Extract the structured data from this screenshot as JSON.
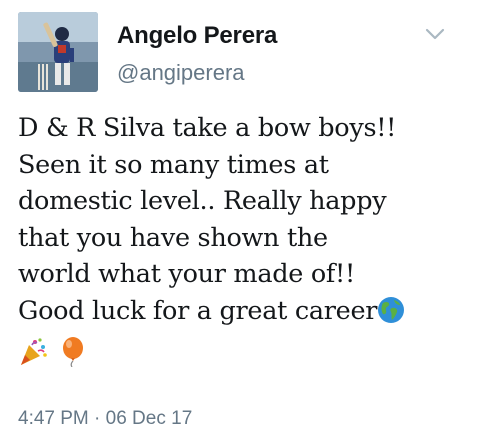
{
  "tweet": {
    "author": {
      "display_name": "Angelo Perera",
      "handle": "@angiperera",
      "avatar_icon": "cricketer-avatar"
    },
    "menu_icon": "chevron-down-icon",
    "body_lines": [
      "D & R Silva take a bow boys!!",
      "Seen it so many times at",
      "domestic level.. Really happy",
      "that you have shown the",
      "world what your made of!!",
      "Good luck for a great career"
    ],
    "emojis": {
      "inline": "globe-americas-icon",
      "trailing": [
        "party-popper-icon",
        "balloon-icon"
      ]
    },
    "timestamp": "4:47 PM · 06 Dec 17"
  },
  "colors": {
    "text_primary": "#14171a",
    "text_secondary": "#657786",
    "chevron": "#aab8c2"
  }
}
